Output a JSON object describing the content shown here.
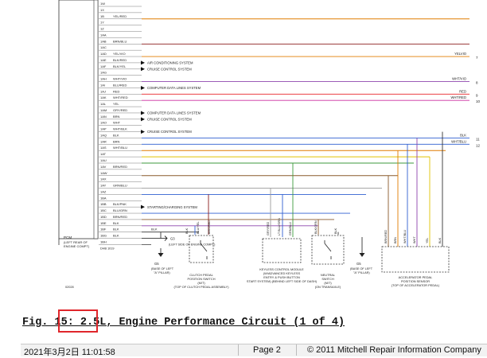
{
  "diagram": {
    "pcm_pins": [
      {
        "pin": "1W",
        "wire": ""
      },
      {
        "pin": "1X",
        "wire": ""
      },
      {
        "pin": "1B",
        "wire": "YEL/RED"
      },
      {
        "pin": "1Y",
        "wire": ""
      },
      {
        "pin": "1Z",
        "wire": ""
      },
      {
        "pin": "1AA",
        "wire": ""
      },
      {
        "pin": "1AB",
        "wire": "BRN/BLU"
      },
      {
        "pin": "1AC",
        "wire": ""
      },
      {
        "pin": "1AD",
        "wire": "YEL/VIO"
      },
      {
        "pin": "1AE",
        "wire": "BLK/RED"
      },
      {
        "pin": "1AF",
        "wire": "BLK/YEL"
      },
      {
        "pin": "1AG",
        "wire": ""
      },
      {
        "pin": "1AH",
        "wire": "WHT/VIO"
      },
      {
        "pin": "1AI",
        "wire": "BLU/RED"
      },
      {
        "pin": "1AJ",
        "wire": "RED"
      },
      {
        "pin": "1AK",
        "wire": "WHT/RED"
      },
      {
        "pin": "1AL",
        "wire": "YEL"
      },
      {
        "pin": "1AM",
        "wire": "GRY/RED"
      },
      {
        "pin": "1AN",
        "wire": "BRN"
      },
      {
        "pin": "1AO",
        "wire": "WHT"
      },
      {
        "pin": "1AP",
        "wire": "WHT/BLK"
      },
      {
        "pin": "1AQ",
        "wire": "BLK"
      },
      {
        "pin": "1AR",
        "wire": "BRN"
      },
      {
        "pin": "1AS",
        "wire": "WHT/BLU"
      },
      {
        "pin": "1AT",
        "wire": ""
      },
      {
        "pin": "1AU",
        "wire": ""
      },
      {
        "pin": "1AV",
        "wire": "BRN/RED"
      },
      {
        "pin": "1AW",
        "wire": ""
      },
      {
        "pin": "1AX",
        "wire": ""
      },
      {
        "pin": "1AY",
        "wire": "GRN/BLU"
      },
      {
        "pin": "1AZ",
        "wire": ""
      },
      {
        "pin": "1BA",
        "wire": ""
      },
      {
        "pin": "1BB",
        "wire": "BLK/PNK"
      },
      {
        "pin": "1BC",
        "wire": "BLU/GRN"
      },
      {
        "pin": "1BD",
        "wire": "BRN/RED"
      },
      {
        "pin": "1BE",
        "wire": "BLK"
      },
      {
        "pin": "1BF",
        "wire": "BLK"
      },
      {
        "pin": "1BG",
        "wire": "BLK"
      },
      {
        "pin": "1BH",
        "wire": ""
      }
    ],
    "arrows": [
      {
        "label": "AIR CONDITIONING SYSTEM",
        "row": 9
      },
      {
        "label": "CRUISE CONTROL SYSTEM",
        "row": 10
      },
      {
        "label": "COMPUTER DATA LINES SYSTEM",
        "row": 13
      },
      {
        "label": "COMPUTER DATA LINES SYSTEM",
        "row": 17
      },
      {
        "label": "CRUISE CONTROL SYSTEM",
        "row": 18
      },
      {
        "label": "CRUISE CONTROL SYSTEM",
        "row": 20
      },
      {
        "label": "STARTING/CHARGING SYSTEM",
        "row": 32
      }
    ],
    "right_labels": [
      {
        "wire": "YELVIO",
        "num": "7"
      },
      {
        "wire": "WHT/VIO",
        "num": "8"
      },
      {
        "wire": "RED",
        "num": "9"
      },
      {
        "wire": "WHT/RED",
        "num": "10"
      },
      {
        "wire": "BLK",
        "num": "11"
      },
      {
        "wire": "WHT/BLU",
        "num": "12"
      }
    ],
    "ground_note": "G3",
    "ground_note2": "(LEFT SIDE OF ENGINE COMPT)",
    "pcm_label_1": "PCM",
    "pcm_label_2": "(LEFT REAR OF",
    "pcm_label_3": "ENGINE COMPT)",
    "dhb_label": "DHB 1019",
    "side_code": "23024",
    "code_bottom": "02028",
    "components": [
      {
        "id": "clutch",
        "l1": "CLUTCH PEDAL",
        "l2": "POSITION SWITCH",
        "l3": "(M/T)",
        "l4": "(TOP OF CLUTCH PEDAL ASSEMBLY)"
      },
      {
        "id": "keyless",
        "l1": "KEYLESS CONTROL MODULE",
        "l2": "(W/ADVANCED KEYLESS",
        "l3": "ENTRY & PUSH BUTTON",
        "l4": "START SYSTEM) (BEHIND LEFT SIDE OF DASH)"
      },
      {
        "id": "neutral",
        "l1": "NEUTRAL",
        "l2": "SWITCH",
        "l3": "(M/T)",
        "l4": "(ON TRANSAXLE)"
      },
      {
        "id": "app",
        "l1": "ACCELERATOR PEDAL",
        "l2": "POSITION SENSOR",
        "l3": "(TOP OF ACCELERATOR PEDAL)",
        "l4": ""
      }
    ],
    "grounds": [
      {
        "id": "g5a",
        "name": "G5",
        "l1": "(BASE OF LEFT",
        "l2": "\"A\" PILLAR)"
      },
      {
        "id": "g5b",
        "name": "G5",
        "l1": "(BASE OF LEFT",
        "l2": "\"A\" PILLAR)"
      }
    ],
    "vertical_wire_labels": {
      "clutch": [
        "BLK",
        "BLU/YEL",
        "BRN/RED"
      ],
      "keyless": [
        "GRY/RED",
        "LT BLU/GRN",
        "GRN/BLU"
      ],
      "neutral": [
        "BLK/GRN",
        "BLK"
      ],
      "app": [
        "BRN/RED",
        "BRN",
        "WHT/BLU",
        "WHT",
        "YEL",
        "BLK"
      ]
    }
  },
  "caption": {
    "text": "Fig. 15: 2.5L, Engine Performance Circuit (1 of 4)"
  },
  "footer": {
    "datetime": "2021年3月2日  11:01:58",
    "page": "Page 2",
    "copyright": "© 2011 Mitchell Repair Information Company"
  },
  "colors": {
    "orange": "#e07b00",
    "purple": "#8e44ad",
    "red": "#e8242a",
    "magenta": "#cc2fa0",
    "blue": "#2f5fd0",
    "yellow": "#e0c200",
    "gray": "#9a9a9a",
    "brown": "#8a5a2b",
    "green": "#3c9a3c",
    "darkred": "#8b1a1a",
    "highlight": "#e0262b"
  }
}
